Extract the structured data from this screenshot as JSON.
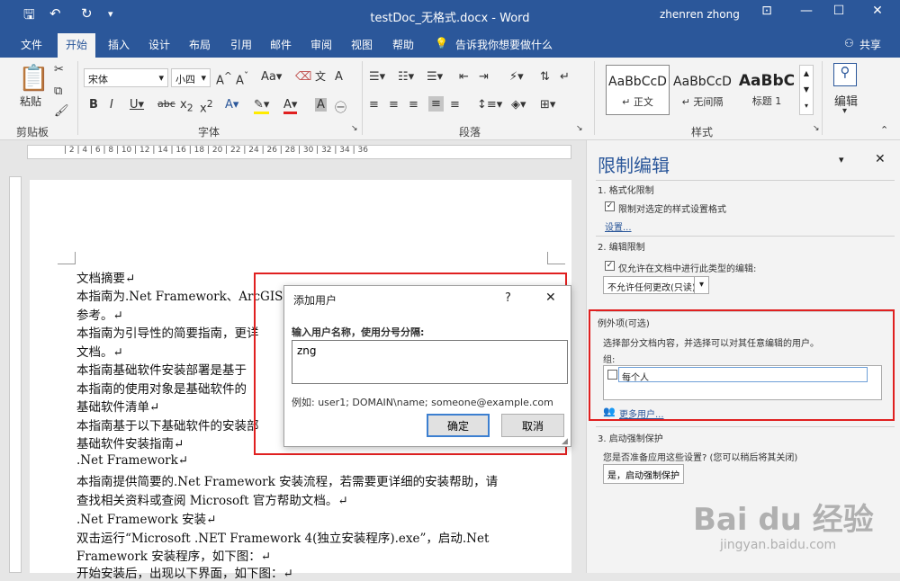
{
  "titlebar": {
    "title": "testDoc_无格式.docx  -  Word",
    "user": "zhenren zhong",
    "qa_save": "🖫",
    "qa_undo": "↶",
    "qa_redo": "↻",
    "qa_custom": "▾",
    "win_ribbon": "⊡",
    "win_min": "—",
    "win_max": "☐",
    "win_close": "✕"
  },
  "tabs": [
    "文件",
    "开始",
    "插入",
    "设计",
    "布局",
    "引用",
    "邮件",
    "审阅",
    "视图",
    "帮助"
  ],
  "tellme": "告诉我你想要做什么",
  "share": "共享",
  "ribbon": {
    "paste": "粘贴",
    "clipboard_label": "剪贴板",
    "font_name": "宋体",
    "font_size": "小四",
    "font_label": "字体",
    "paragraph_label": "段落",
    "styles_label": "样式",
    "editing": "编辑",
    "styles": [
      {
        "sample": "AaBbCcD",
        "name": "↵ 正文"
      },
      {
        "sample": "AaBbCcD",
        "name": "↵ 无间隔"
      },
      {
        "sample": "AaBbC",
        "name": "标题 1"
      }
    ]
  },
  "ruler_text": "|  2  |  4  |  6  |  8  |  10  |  12  |  14  |  16  |  18  |  20  |  22  |  24  |  26  |  28  |  30  |  32  |  34  |  36",
  "document": [
    "文档摘要↵",
    "本指南为.Net Framework、ArcGIS1",
    "参考。↵",
    "本指南为引导性的简要指南，更详",
    "文档。↵",
    "本指南基础软件安装部署是基于",
    "本指南的使用对象是基础软件的",
    "基础软件清单↵",
    "本指南基于以下基础软件的安装部",
    "基础软件安装指南↵",
    ".Net Framework↵",
    "本指南提供简要的.Net Framework 安装流程，若需要更详细的安装帮助，请",
    "查找相关资料或查阅 Microsoft 官方帮助文档。↵",
    ".Net Framework 安装↵",
    "双击运行“Microsoft .NET Framework 4(独立安装程序).exe”，启动.Net",
    "Framework 安装程序，如下图：↵",
    "开始安装后，出现以下界面，如下图：↵"
  ],
  "dialog": {
    "title": "添加用户",
    "help": "?",
    "close": "✕",
    "prompt": "输入用户名称，使用分号分隔:",
    "value": "zng",
    "example": "例如: user1; DOMAIN\\name; someone@example.com",
    "ok": "确定",
    "cancel": "取消"
  },
  "pane": {
    "title": "限制编辑",
    "section1": "1. 格式化限制",
    "format_check": "限制对选定的样式设置格式",
    "settings": "设置...",
    "section2": "2. 编辑限制",
    "edit_check": "仅允许在文档中进行此类型的编辑:",
    "edit_type": "不允许任何更改(只读)",
    "exceptions": "例外项(可选)",
    "exceptions_desc": "选择部分文档内容，并选择可以对其任意编辑的用户。",
    "groups": "组:",
    "everyone": "每个人",
    "more_users": "更多用户...",
    "section3": "3. 启动强制保护",
    "question": "您是否准备应用这些设置? (您可以稍后将其关闭)",
    "enforce": "是，启动强制保护"
  },
  "watermark": {
    "brand": "Bai du 经验",
    "url": "jingyan.baidu.com"
  }
}
